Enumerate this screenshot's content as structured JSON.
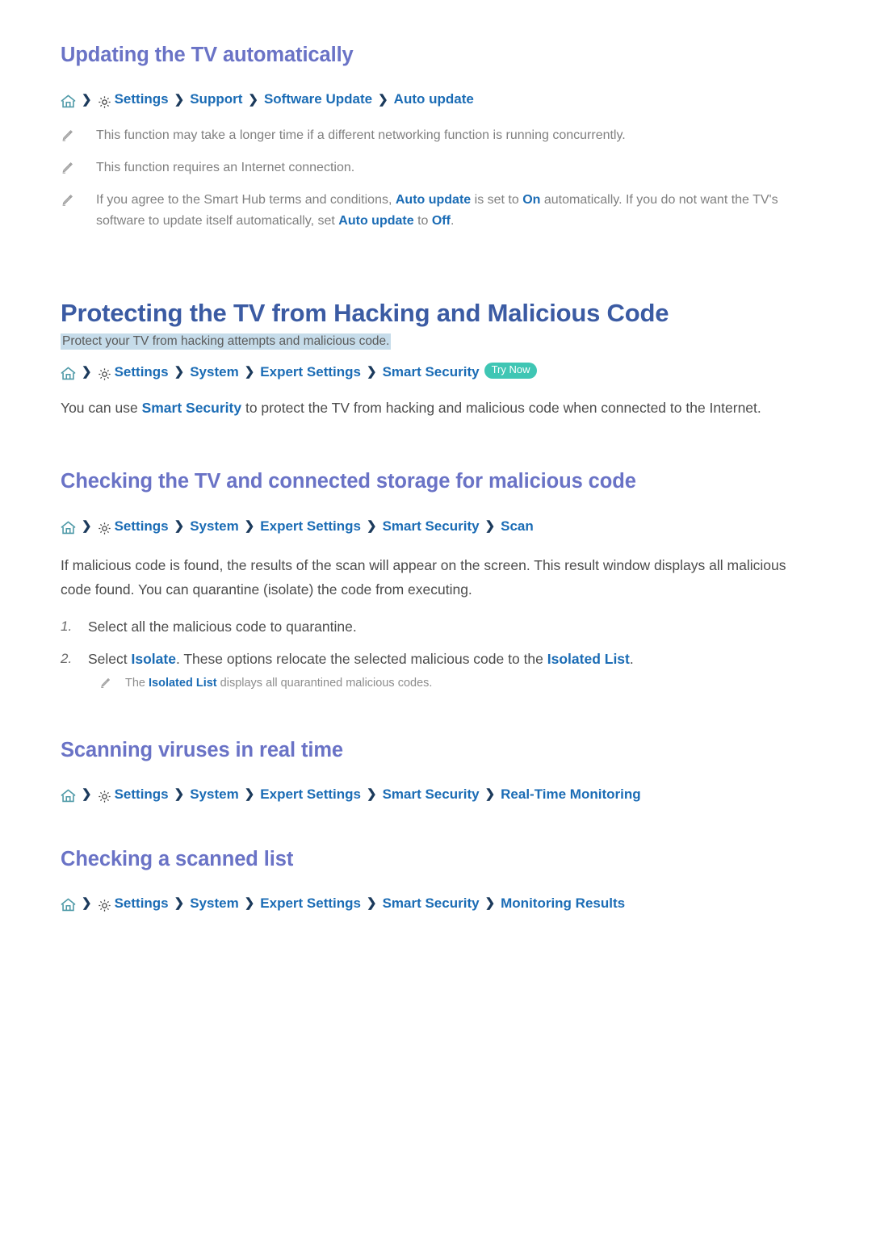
{
  "section_update": {
    "heading": "Updating the TV automatically",
    "breadcrumb": {
      "home_icon": "home-icon",
      "gear_icon": "gear-icon",
      "crumbs": [
        "Settings",
        "Support",
        "Software Update",
        "Auto update"
      ],
      "separator": "❯"
    },
    "notes": [
      {
        "icon": "pencil-icon",
        "parts": [
          {
            "text": "This function may take a longer time if a different networking function is running concurrently.",
            "style": "plain"
          }
        ]
      },
      {
        "icon": "pencil-icon",
        "parts": [
          {
            "text": "This function requires an Internet connection.",
            "style": "plain"
          }
        ]
      },
      {
        "icon": "pencil-icon",
        "parts": [
          {
            "text": "If you agree to the Smart Hub terms and conditions, ",
            "style": "plain"
          },
          {
            "text": "Auto update",
            "style": "blue"
          },
          {
            "text": " is set to ",
            "style": "plain"
          },
          {
            "text": "On",
            "style": "blue"
          },
          {
            "text": " automatically. If you do not want the TV's software to update itself automatically, set ",
            "style": "plain"
          },
          {
            "text": "Auto update",
            "style": "blue"
          },
          {
            "text": " to ",
            "style": "plain"
          },
          {
            "text": "Off",
            "style": "blue"
          },
          {
            "text": ".",
            "style": "plain"
          }
        ]
      }
    ]
  },
  "section_protect": {
    "heading": "Protecting the TV from Hacking and Malicious Code",
    "subtitle": "Protect your TV from hacking attempts and malicious code.",
    "breadcrumb": {
      "home_icon": "home-icon",
      "gear_icon": "gear-icon",
      "crumbs": [
        "Settings",
        "System",
        "Expert Settings",
        "Smart Security"
      ],
      "badge": "Try Now",
      "separator": "❯"
    },
    "paragraph": [
      {
        "text": "You can use ",
        "style": "plain"
      },
      {
        "text": "Smart Security",
        "style": "blue"
      },
      {
        "text": " to protect the TV from hacking and malicious code when connected to the Internet.",
        "style": "plain"
      }
    ]
  },
  "section_scan": {
    "heading": "Checking the TV and connected storage for malicious code",
    "breadcrumb": {
      "home_icon": "home-icon",
      "gear_icon": "gear-icon",
      "crumbs": [
        "Settings",
        "System",
        "Expert Settings",
        "Smart Security",
        "Scan"
      ],
      "separator": "❯"
    },
    "paragraph": [
      {
        "text": "If malicious code is found, the results of the scan will appear on the screen. This result window displays all malicious code found. You can quarantine (isolate) the code from executing.",
        "style": "plain"
      }
    ],
    "steps": [
      {
        "number": "1.",
        "parts": [
          {
            "text": "Select all the malicious code to quarantine.",
            "style": "plain"
          }
        ]
      },
      {
        "number": "2.",
        "parts": [
          {
            "text": "Select ",
            "style": "plain"
          },
          {
            "text": "Isolate",
            "style": "blue"
          },
          {
            "text": ". These options relocate the selected malicious code to the ",
            "style": "plain"
          },
          {
            "text": "Isolated List",
            "style": "blue"
          },
          {
            "text": ".",
            "style": "plain"
          }
        ]
      }
    ],
    "sub_note": {
      "icon": "pencil-icon",
      "parts": [
        {
          "text": "The ",
          "style": "plain"
        },
        {
          "text": "Isolated List",
          "style": "blue"
        },
        {
          "text": " displays all quarantined malicious codes.",
          "style": "plain"
        }
      ]
    }
  },
  "section_realtime": {
    "heading": "Scanning viruses in real time",
    "breadcrumb": {
      "home_icon": "home-icon",
      "gear_icon": "gear-icon",
      "crumbs": [
        "Settings",
        "System",
        "Expert Settings",
        "Smart Security",
        "Real-Time Monitoring"
      ],
      "separator": "❯"
    }
  },
  "section_results": {
    "heading": "Checking a scanned list",
    "breadcrumb": {
      "home_icon": "home-icon",
      "gear_icon": "gear-icon",
      "crumbs": [
        "Settings",
        "System",
        "Expert Settings",
        "Smart Security",
        "Monitoring Results"
      ],
      "separator": "❯"
    }
  },
  "colors": {
    "h1": "#3b5ba3",
    "h2": "#6a73c6",
    "link": "#1b6cb5",
    "chevron": "#1b3a5c",
    "highlight": "#c6dcea",
    "badge": "#3fc6b4",
    "note_text": "#808080",
    "body_text": "#4c4c4c",
    "home_icon": "#4f9aa8"
  }
}
